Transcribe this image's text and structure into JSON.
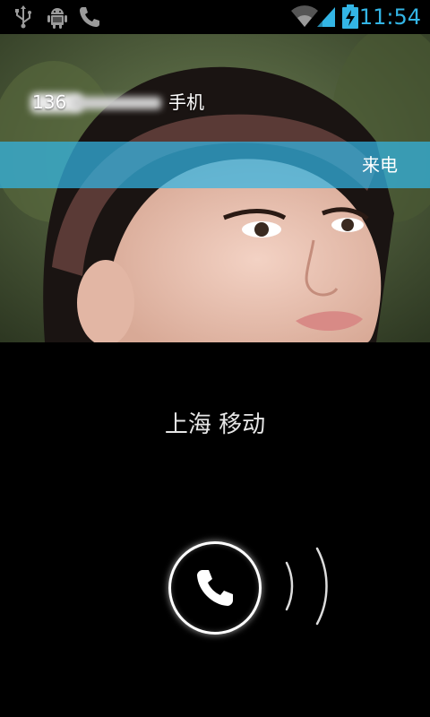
{
  "status_bar": {
    "time": "11:54",
    "left_icons": [
      "usb-icon",
      "android-debug-icon",
      "phone-icon"
    ],
    "right_icons": [
      "wifi-icon",
      "signal-icon",
      "battery-charging-icon"
    ],
    "accent_color": "#33b5e5"
  },
  "caller": {
    "number_prefix": "136",
    "number_type": "手机"
  },
  "call": {
    "state_label": "来电",
    "location": "上海 移动",
    "banner_color": "#33b5e5"
  },
  "controls": {
    "answer_icon": "phone-handset-icon"
  }
}
